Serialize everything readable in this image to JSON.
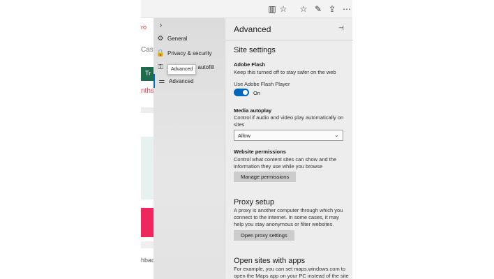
{
  "toolbar": {
    "icons": [
      "reading-view-icon",
      "favorite-star-icon",
      "favorites-hub-icon",
      "pen-icon",
      "share-icon",
      "more-icon"
    ],
    "glyphs": [
      "▥",
      "☆",
      "☆",
      "✎",
      "⇪",
      "⋯"
    ]
  },
  "background_page": {
    "red_text": "ro",
    "cashback_text": "Cashb",
    "green_button": "Tr",
    "months_text": "nths",
    "bottom_text": "hbac"
  },
  "nav": {
    "chevron": "›",
    "items": [
      {
        "label": "General",
        "icon": "gear-icon",
        "glyph": "⚙"
      },
      {
        "label": "Privacy & security",
        "icon": "lock-icon",
        "glyph": "🔒"
      },
      {
        "label": "& autofill",
        "icon": "key-icon",
        "glyph": "⚿"
      },
      {
        "label": "Advanced",
        "icon": "sliders-icon",
        "glyph": "⚌"
      }
    ],
    "tooltip": "Advanced"
  },
  "panel": {
    "title": "Advanced",
    "pin_glyph": "⊣",
    "site_settings": "Site settings",
    "flash": {
      "heading": "Adobe Flash",
      "desc": "Keep this turned off to stay safer on the web",
      "toggle_label": "Use Adobe Flash Player",
      "toggle_state": "On",
      "enabled": true
    },
    "autoplay": {
      "heading": "Media autoplay",
      "desc": "Control if audio and video play automatically on sites",
      "selected": "Allow"
    },
    "permissions": {
      "heading": "Website permissions",
      "desc": "Control what content sites can show and the information they use while you browse",
      "button": "Manage permissions"
    },
    "proxy": {
      "heading": "Proxy setup",
      "desc": "A proxy is another computer through which you connect to the internet. In some cases, it may help you stay anonymous or filter websites.",
      "button": "Open proxy settings"
    },
    "open_sites": {
      "heading": "Open sites with apps",
      "desc": "For example, you can set maps.windows.com to open the Maps app on your PC instead of the site"
    }
  },
  "colors": {
    "accent": "#0067c0",
    "toggle_on": "#0067c0",
    "page_red": "#d83b3b",
    "page_green": "#1e6b4d",
    "page_pink": "#f0265f"
  }
}
